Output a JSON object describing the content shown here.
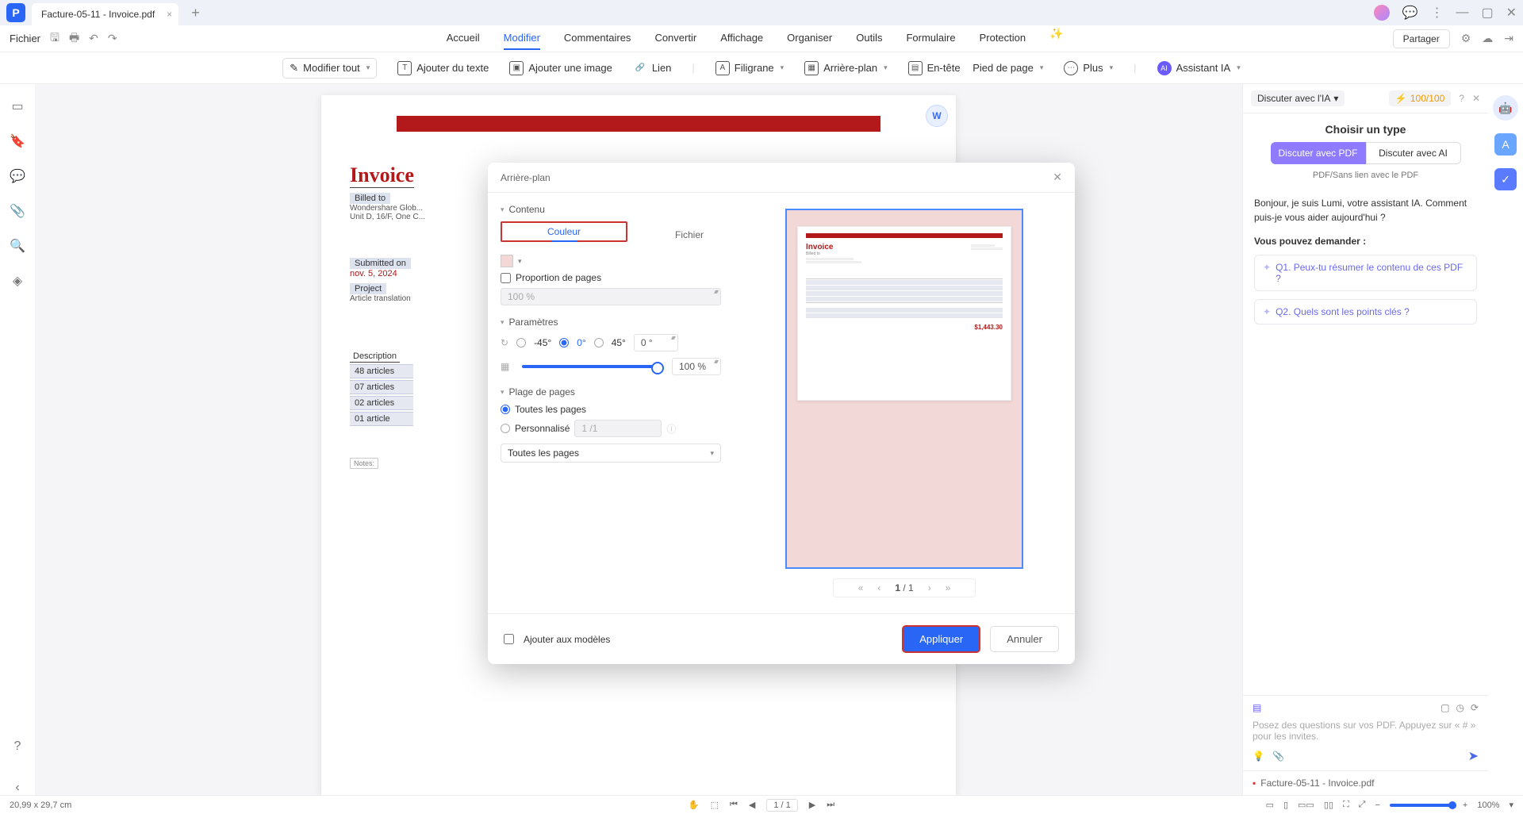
{
  "tab": {
    "title": "Facture-05-11 - Invoice.pdf"
  },
  "menu": {
    "file": "Fichier",
    "items": [
      "Accueil",
      "Modifier",
      "Commentaires",
      "Convertir",
      "Affichage",
      "Organiser",
      "Outils",
      "Formulaire",
      "Protection"
    ],
    "active": "Modifier",
    "share": "Partager"
  },
  "toolbar": {
    "edit_all": "Modifier tout",
    "add_text": "Ajouter du texte",
    "add_image": "Ajouter une image",
    "link": "Lien",
    "watermark": "Filigrane",
    "background": "Arrière-plan",
    "header_footer1": "En-tête",
    "header_footer2": "Pied de page",
    "more": "Plus",
    "assistant": "Assistant IA"
  },
  "doc": {
    "invoice_title": "Invoice",
    "billed_to": "Billed to",
    "comp1": "Wondershare Glob...",
    "comp2": "Unit D, 16/F, One C...",
    "submitted": "Submitted on",
    "date": "nov. 5, 2024",
    "project": "Project",
    "project_val": "Article translation",
    "desc": "Description",
    "rows": [
      "48 articles",
      "07 articles",
      "02 articles",
      "01 article"
    ],
    "notes": "Notes:"
  },
  "modal": {
    "title": "Arrière-plan",
    "content": "Contenu",
    "tab_color": "Couleur",
    "tab_file": "Fichier",
    "proportion": "Proportion de pages",
    "prop_val": "100 %",
    "params": "Paramètres",
    "deg_n45": "-45°",
    "deg_0": "0°",
    "deg_45": "45°",
    "deg_input": "0 °",
    "opacity_val": "100 %",
    "range": "Plage de pages",
    "all_pages": "Toutes les pages",
    "custom": "Personnalisé",
    "custom_ph": "1 /1",
    "range_select": "Toutes les pages",
    "preview_nav": {
      "page": "1",
      "total": "/ 1"
    },
    "preview": {
      "invoice": "Invoice",
      "billed": "Billed to",
      "total": "$1,443.30"
    },
    "add_tpl": "Ajouter aux modèles",
    "apply": "Appliquer",
    "cancel": "Annuler"
  },
  "chat": {
    "dd": "Discuter avec l'IA",
    "tokens": "100/100",
    "choose": "Choisir un type",
    "t1": "Discuter avec PDF",
    "t2": "Discuter avec AI",
    "sub": "PDF/Sans lien avec le PDF",
    "welcome": "Bonjour, je suis Lumi, votre assistant IA. Comment puis-je vous aider aujourd'hui ?",
    "ask": "Vous pouvez demander :",
    "q1": "Q1. Peux-tu résumer le contenu de ces PDF ?",
    "q2": "Q2. Quels sont les points clés ?",
    "placeholder": "Posez des questions sur vos PDF. Appuyez sur « # » pour les invites.",
    "file": "Facture-05-11 - Invoice.pdf"
  },
  "status": {
    "dims": "20,99 x 29,7 cm",
    "page": "1",
    "pages": "/ 1",
    "zoom": "100%"
  }
}
